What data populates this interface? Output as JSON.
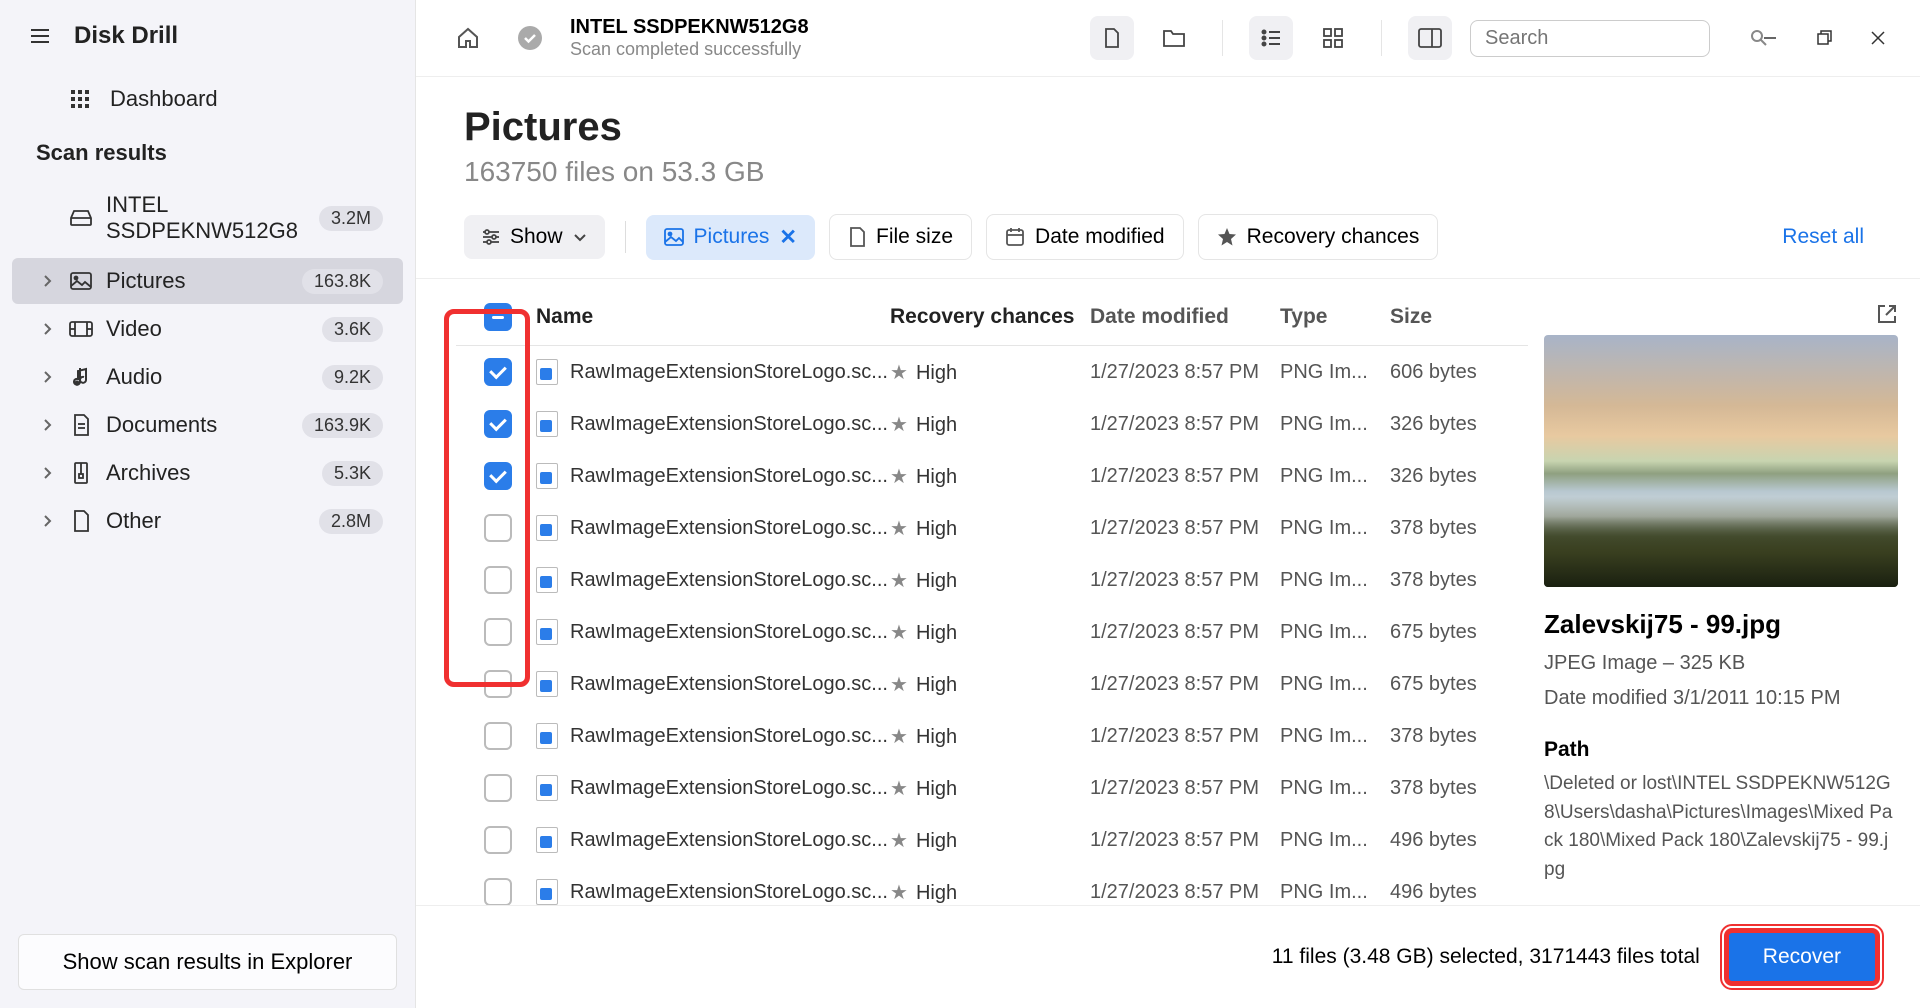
{
  "app": {
    "title": "Disk Drill"
  },
  "sidebar": {
    "dashboard": "Dashboard",
    "scan_results_label": "Scan results",
    "drive": {
      "name": "INTEL SSDPEKNW512G8",
      "count": "3.2M"
    },
    "categories": [
      {
        "label": "Pictures",
        "count": "163.8K",
        "active": true
      },
      {
        "label": "Video",
        "count": "3.6K"
      },
      {
        "label": "Audio",
        "count": "9.2K"
      },
      {
        "label": "Documents",
        "count": "163.9K"
      },
      {
        "label": "Archives",
        "count": "5.3K"
      },
      {
        "label": "Other",
        "count": "2.8M"
      }
    ],
    "explorer_btn": "Show scan results in Explorer"
  },
  "topbar": {
    "title": "INTEL SSDPEKNW512G8",
    "subtitle": "Scan completed successfully",
    "search_placeholder": "Search"
  },
  "page": {
    "title": "Pictures",
    "subtitle": "163750 files on 53.3 GB"
  },
  "filters": {
    "show": "Show",
    "pictures": "Pictures",
    "filesize": "File size",
    "datemod": "Date modified",
    "recchance": "Recovery chances",
    "reset": "Reset all"
  },
  "columns": {
    "name": "Name",
    "rec": "Recovery chances",
    "date": "Date modified",
    "type": "Type",
    "size": "Size"
  },
  "rows": [
    {
      "checked": true,
      "name": "RawImageExtensionStoreLogo.sc...",
      "rec": "High",
      "date": "1/27/2023 8:57 PM",
      "type": "PNG Im...",
      "size": "606 bytes"
    },
    {
      "checked": true,
      "name": "RawImageExtensionStoreLogo.sc...",
      "rec": "High",
      "date": "1/27/2023 8:57 PM",
      "type": "PNG Im...",
      "size": "326 bytes"
    },
    {
      "checked": true,
      "name": "RawImageExtensionStoreLogo.sc...",
      "rec": "High",
      "date": "1/27/2023 8:57 PM",
      "type": "PNG Im...",
      "size": "326 bytes"
    },
    {
      "checked": false,
      "name": "RawImageExtensionStoreLogo.sc...",
      "rec": "High",
      "date": "1/27/2023 8:57 PM",
      "type": "PNG Im...",
      "size": "378 bytes"
    },
    {
      "checked": false,
      "name": "RawImageExtensionStoreLogo.sc...",
      "rec": "High",
      "date": "1/27/2023 8:57 PM",
      "type": "PNG Im...",
      "size": "378 bytes"
    },
    {
      "checked": false,
      "name": "RawImageExtensionStoreLogo.sc...",
      "rec": "High",
      "date": "1/27/2023 8:57 PM",
      "type": "PNG Im...",
      "size": "675 bytes"
    },
    {
      "checked": false,
      "name": "RawImageExtensionStoreLogo.sc...",
      "rec": "High",
      "date": "1/27/2023 8:57 PM",
      "type": "PNG Im...",
      "size": "675 bytes"
    },
    {
      "checked": false,
      "name": "RawImageExtensionStoreLogo.sc...",
      "rec": "High",
      "date": "1/27/2023 8:57 PM",
      "type": "PNG Im...",
      "size": "378 bytes"
    },
    {
      "checked": false,
      "name": "RawImageExtensionStoreLogo.sc...",
      "rec": "High",
      "date": "1/27/2023 8:57 PM",
      "type": "PNG Im...",
      "size": "378 bytes"
    },
    {
      "checked": false,
      "name": "RawImageExtensionStoreLogo.sc...",
      "rec": "High",
      "date": "1/27/2023 8:57 PM",
      "type": "PNG Im...",
      "size": "496 bytes"
    },
    {
      "checked": false,
      "name": "RawImageExtensionStoreLogo.sc...",
      "rec": "High",
      "date": "1/27/2023 8:57 PM",
      "type": "PNG Im...",
      "size": "496 bytes"
    }
  ],
  "preview": {
    "title": "Zalevskij75 - 99.jpg",
    "type_size": "JPEG Image – 325 KB",
    "date": "Date modified 3/1/2011 10:15 PM",
    "path_label": "Path",
    "path": "\\Deleted or lost\\INTEL SSDPEKNW512G8\\Users\\dasha\\Pictures\\Images\\Mixed Pack 180\\Mixed  Pack 180\\Zalevskij75 - 99.jpg"
  },
  "footer": {
    "status": "11 files (3.48 GB) selected, 3171443 files total",
    "recover": "Recover"
  }
}
